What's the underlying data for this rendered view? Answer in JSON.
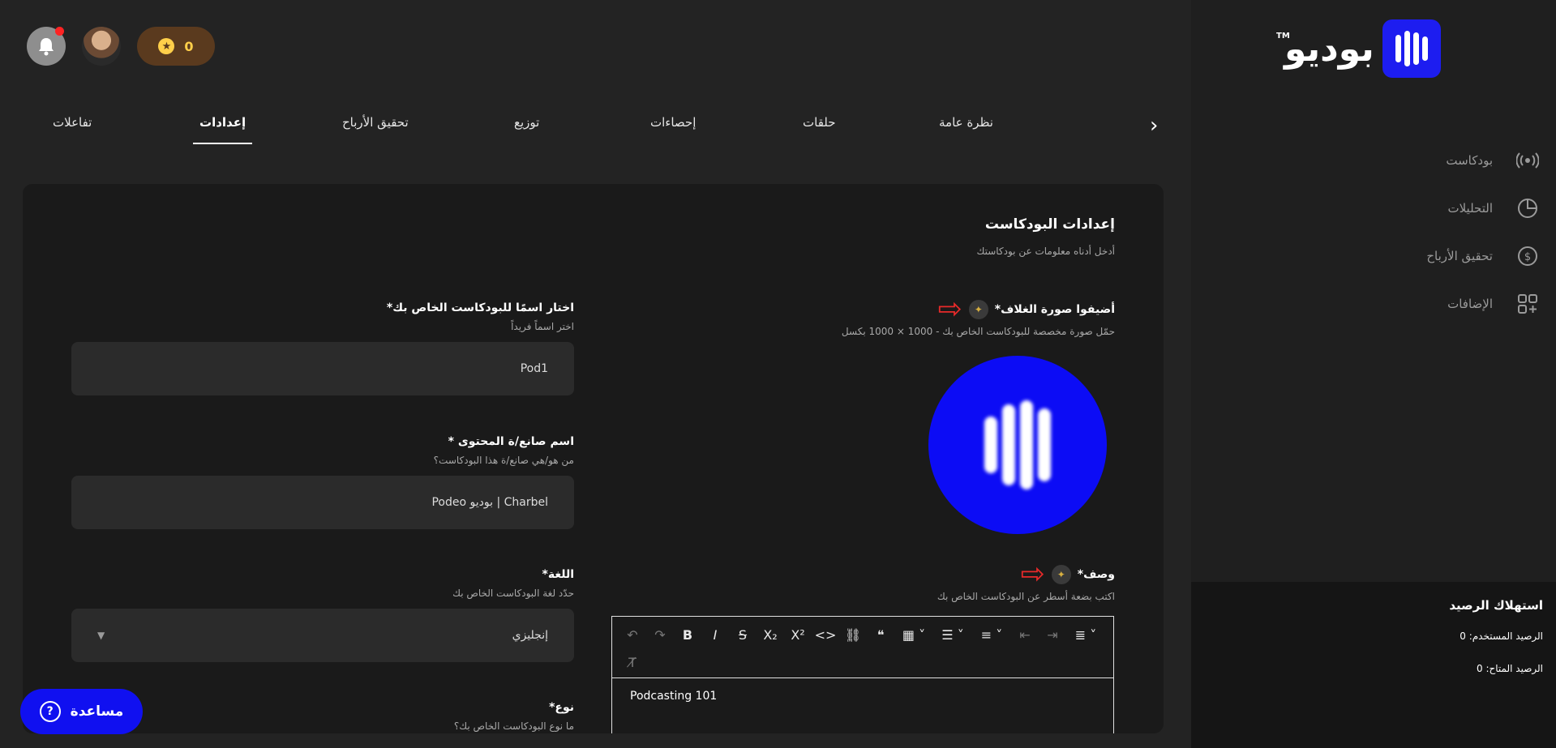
{
  "brand": {
    "name": "بوديو",
    "tm": "TM"
  },
  "topbar": {
    "points": "0"
  },
  "sidebar": {
    "items": [
      {
        "label": "بودكاست",
        "icon": "broadcast-icon"
      },
      {
        "label": "التحليلات",
        "icon": "pie-chart-icon"
      },
      {
        "label": "تحقيق الأرباح",
        "icon": "dollar-icon"
      },
      {
        "label": "الإضافات",
        "icon": "add-grid-icon"
      }
    ],
    "balance": {
      "title": "استهلاك الرصيد",
      "used": "الرصيد المستخدم: 0",
      "available": "الرصيد المتاح: 0"
    }
  },
  "tabs": [
    {
      "label": "نظرة عامة"
    },
    {
      "label": "حلقات"
    },
    {
      "label": "إحصاءات"
    },
    {
      "label": "توزيع"
    },
    {
      "label": "تحقيق الأرباح"
    },
    {
      "label": "إعدادات",
      "active": true
    },
    {
      "label": "تفاعلات"
    }
  ],
  "settings": {
    "title": "إعدادات البودكاست",
    "subtitle": "أدخل أدناه معلومات عن بودكاستك",
    "cover": {
      "label": "أضيفوا صورة الغلاف*",
      "hint": "حمّل صورة مخصصة للبودكاست الخاص بك - 1000 × 1000 بكسل"
    },
    "description": {
      "label": "وصف*",
      "hint": "اكتب بضعة أسطر عن البودكاست الخاص بك",
      "value": "Podcasting 101"
    },
    "name": {
      "label": "اختار اسمًا للبودكاست الخاص بك*",
      "hint": "اختر اسماً فريداً",
      "value": "Pod1"
    },
    "creator": {
      "label": "اسم صانع/ة المحتوى *",
      "hint": "من هو/هي صانع/ة هذا البودكاست؟",
      "value": "Charbel | بوديو Podeo"
    },
    "language": {
      "label": "اللغة*",
      "hint": "حدّد لغة البودكاست الخاص بك",
      "value": "إنجليزي"
    },
    "genre": {
      "label": "نوع*",
      "hint": "ما نوع البودكاست الخاص بك؟"
    }
  },
  "help": {
    "label": "مساعدة"
  },
  "colors": {
    "accent": "#1010f0",
    "notification": "#ff2323",
    "arrow": "#e82a2a"
  }
}
